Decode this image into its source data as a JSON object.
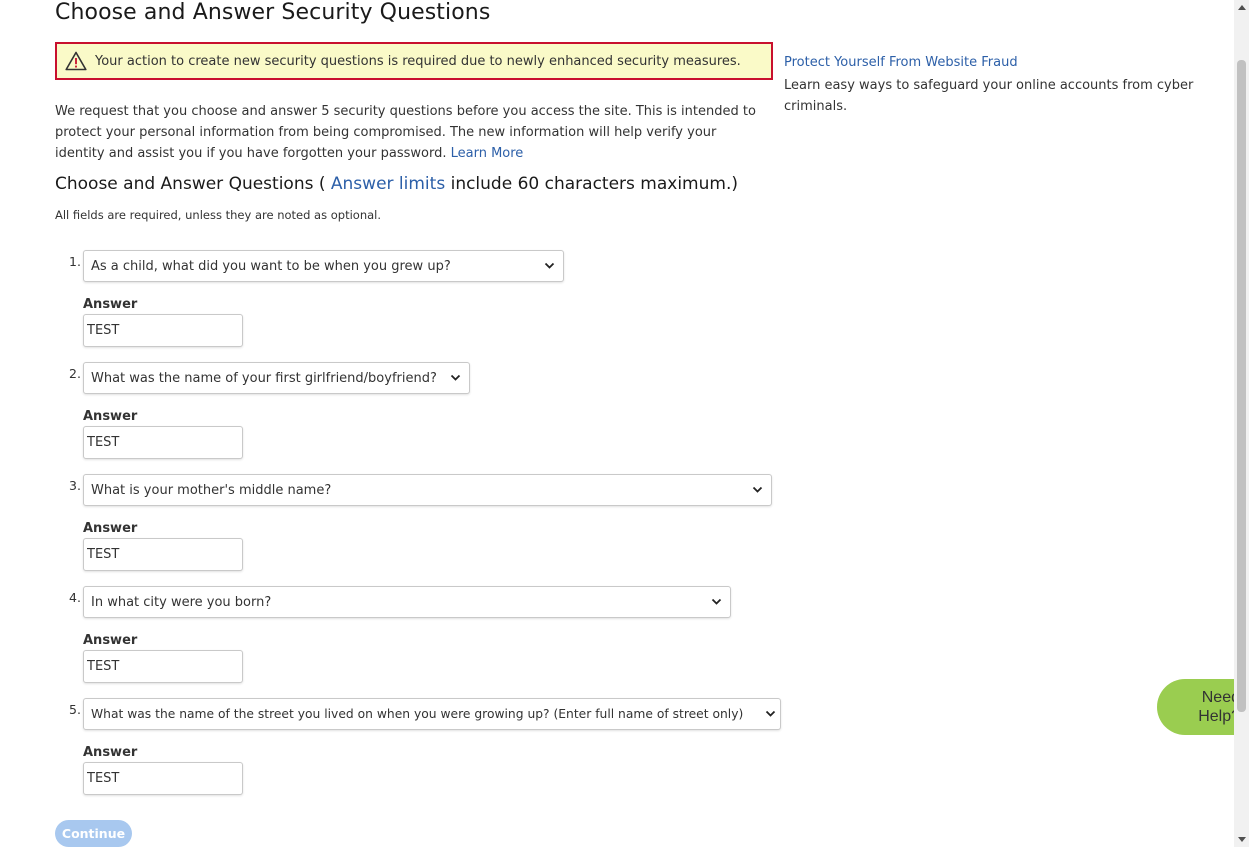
{
  "page": {
    "title": "Choose and Answer Security Questions"
  },
  "alert": {
    "icon": "warning-triangle-icon",
    "text": "Your action to create new security questions is required due to newly enhanced security measures.",
    "border_color": "#c8102e",
    "background_color": "#fafac8"
  },
  "intro": {
    "text": "We request that you choose and answer 5 security questions before you access the site. This is intended to protect your personal information from being compromised. The new information will help verify your identity and assist you if you have forgotten your password. ",
    "learn_more": "Learn More"
  },
  "questions_section": {
    "heading_prefix": "Choose and Answer Questions ( ",
    "heading_link": "Answer limits",
    "heading_suffix": " include 60 characters maximum.)",
    "required_note": "All fields are required, unless they are noted as optional.",
    "answer_label": "Answer",
    "items": [
      {
        "number": "1.",
        "question": "As a child, what did you want to be when you grew up?",
        "answer": "TEST"
      },
      {
        "number": "2.",
        "question": "What was the name of your first girlfriend/boyfriend?",
        "answer": "TEST"
      },
      {
        "number": "3.",
        "question": "What is your mother's middle name?",
        "answer": "TEST"
      },
      {
        "number": "4.",
        "question": "In what city were you born?",
        "answer": "TEST"
      },
      {
        "number": "5.",
        "question": "What was the name of the street you lived on when you were growing up? (Enter full name of street only)",
        "answer": "TEST"
      }
    ]
  },
  "continue_button": {
    "label": "Continue",
    "state": "disabled",
    "color": "#a8c8ef"
  },
  "sidebar": {
    "link": "Protect Yourself From Website Fraud",
    "description": "Learn easy ways to safeguard your online accounts from cyber criminals."
  },
  "help_widget": {
    "line1": "Need",
    "line2": "Help?",
    "color": "#9acd50"
  },
  "colors": {
    "link": "#2c5fa8",
    "text": "#333333"
  }
}
